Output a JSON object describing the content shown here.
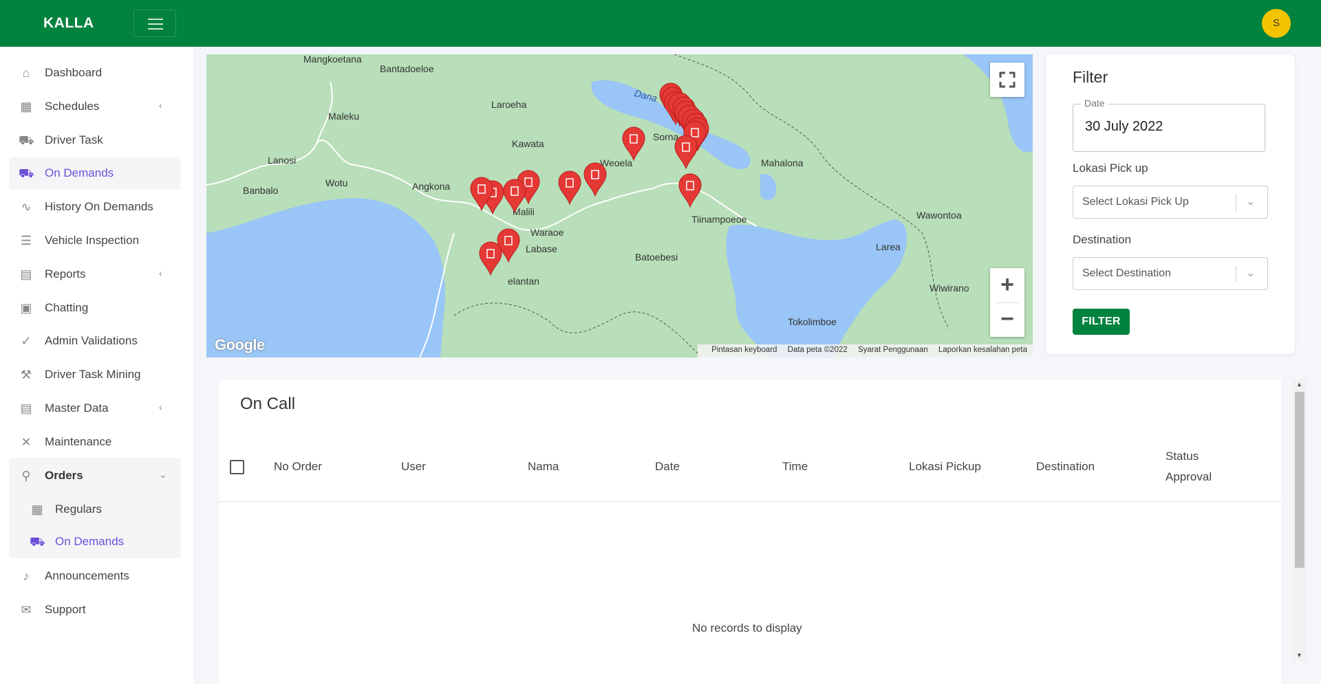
{
  "app": {
    "brand": "KALLA",
    "avatar_initial": "S"
  },
  "colors": {
    "primary": "#01823d",
    "accent_active": "#6b4fd8",
    "avatar": "#f5c400",
    "marker": "#e53935",
    "water": "#99c5f7",
    "land": "#b8dfb9"
  },
  "sidebar": {
    "items": [
      {
        "label": "Dashboard",
        "icon": "home-icon"
      },
      {
        "label": "Schedules",
        "icon": "calendar-icon",
        "has_children": true
      },
      {
        "label": "Driver Task",
        "icon": "car-icon"
      },
      {
        "label": "On Demands",
        "icon": "car-icon",
        "active": true
      },
      {
        "label": "History On Demands",
        "icon": "chart-icon"
      },
      {
        "label": "Vehicle Inspection",
        "icon": "list-icon"
      },
      {
        "label": "Reports",
        "icon": "report-icon",
        "has_children": true
      },
      {
        "label": "Chatting",
        "icon": "chat-icon"
      },
      {
        "label": "Admin Validations",
        "icon": "check-circle-icon"
      },
      {
        "label": "Driver Task Mining",
        "icon": "hammer-icon"
      },
      {
        "label": "Master Data",
        "icon": "database-icon",
        "has_children": true
      },
      {
        "label": "Maintenance",
        "icon": "tools-icon"
      },
      {
        "label": "Orders",
        "icon": "map-icon",
        "expanded": true
      },
      {
        "label": "Announcements",
        "icon": "bell-icon"
      },
      {
        "label": "Support",
        "icon": "envelope-icon"
      }
    ],
    "orders_children": [
      {
        "label": "Regulars",
        "icon": "calendar-icon"
      },
      {
        "label": "On Demands",
        "icon": "car-icon",
        "active": true
      }
    ]
  },
  "map": {
    "places": [
      "Mangkoetana",
      "Bantadoeloe",
      "Laroeha",
      "Maleku",
      "Kawata",
      "Lanosi",
      "Wotu",
      "Banbalo",
      "Angkona",
      "Malili",
      "Waraoe",
      "Labase",
      "Weoela",
      "Sorna",
      "Mahalona",
      "Tiinampoeoe",
      "Batoebesi",
      "Wawontoa",
      "Larea",
      "Wiwirano",
      "Tokolimboe",
      "elantan",
      "Dana"
    ],
    "google_logo": "Google",
    "attribution": [
      "Pintasan keyboard",
      "Data peta ©2022",
      "Syarat Penggunaan",
      "Laporkan kesalahan peta"
    ],
    "controls": {
      "fullscreen": "fullscreen-icon",
      "zoom_in": "+",
      "zoom_out": "−"
    }
  },
  "filter": {
    "title": "Filter",
    "date_label": "Date",
    "date_value": "30 July 2022",
    "pickup_label": "Lokasi Pick up",
    "pickup_placeholder": "Select Lokasi Pick Up",
    "destination_label": "Destination",
    "destination_placeholder": "Select Destination",
    "button_label": "FILTER"
  },
  "oncall": {
    "title": "On Call",
    "columns": [
      "No Order",
      "User",
      "Nama",
      "Date",
      "Time",
      "Lokasi Pickup",
      "Destination",
      "Status",
      "Approval"
    ],
    "empty_message": "No records to display"
  }
}
